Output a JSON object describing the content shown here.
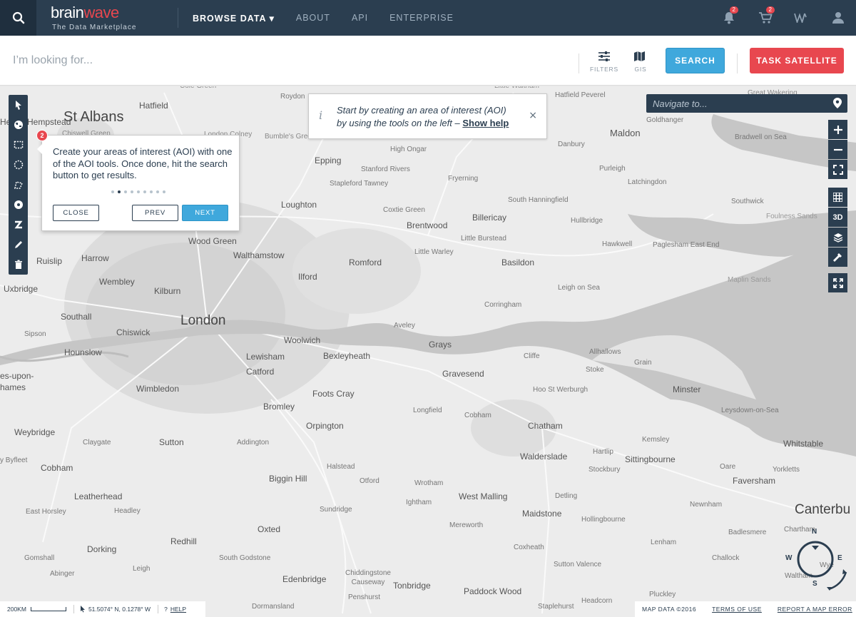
{
  "header": {
    "logo_main": "brain",
    "logo_accent": "wave",
    "logo_tagline": "The Data Marketplace",
    "nav": [
      {
        "label": "BROWSE DATA ▾",
        "active": true
      },
      {
        "label": "ABOUT",
        "active": false
      },
      {
        "label": "API",
        "active": false
      },
      {
        "label": "ENTERPRISE",
        "active": false
      }
    ],
    "notifications_count": "2",
    "cart_count": "2"
  },
  "search": {
    "placeholder": "I’m looking for...",
    "filters_label": "FILTERS",
    "gis_label": "GIS",
    "search_button": "SEARCH",
    "task_button": "TASK SATELLITE"
  },
  "tip": {
    "line1": "Start by creating an area of interest (AOI)",
    "line2": "by using the tools on the left –",
    "link": "Show help",
    "close": "×"
  },
  "tour": {
    "step": "2",
    "text": "Create your areas of interest (AOI) with one of the AOI tools. Once done, hit the search button to get results.",
    "total_steps": 9,
    "current_step": 2,
    "close": "CLOSE",
    "prev": "PREV",
    "next": "NEXT"
  },
  "navigate": {
    "placeholder": "Navigate to..."
  },
  "right_tools": {
    "three_d": "3D"
  },
  "compass": {
    "n": "N",
    "s": "S",
    "e": "E",
    "w": "W"
  },
  "footer": {
    "scale": "200KM",
    "coords": "51.5074° N, 0.1278° W",
    "help": "HELP",
    "map_data": "MAP DATA ©2016",
    "terms": "TERMS OF USE",
    "report": "REPORT A MAP ERROR"
  },
  "places": [
    {
      "t": "St Albans",
      "s": 20,
      "c": "#444"
    },
    {
      "t": "Hatfield",
      "s": 12
    },
    {
      "t": "Hemel Hempstead",
      "s": 12
    },
    {
      "t": "Cole Green",
      "s": 10,
      "c": "#888"
    },
    {
      "t": "Roydon",
      "s": 10,
      "c": "#777"
    },
    {
      "t": "Little Waltham",
      "s": 10,
      "c": "#888"
    },
    {
      "t": "Hatfield Peverel",
      "s": 10,
      "c": "#777"
    },
    {
      "t": "Great Wakering",
      "s": 10,
      "c": "#888"
    },
    {
      "t": "Goldhanger",
      "s": 10,
      "c": "#777"
    },
    {
      "t": "Maldon",
      "s": 13
    },
    {
      "t": "Bradwell on Sea",
      "s": 10,
      "c": "#777"
    },
    {
      "t": "Danbury",
      "s": 10,
      "c": "#777"
    },
    {
      "t": "Chiswell Green",
      "s": 10,
      "c": "#888"
    },
    {
      "t": "London Colney",
      "s": 10,
      "c": "#888"
    },
    {
      "t": "Bumble's Green",
      "s": 10,
      "c": "#888"
    },
    {
      "t": "High Ongar",
      "s": 10,
      "c": "#777"
    },
    {
      "t": "Epping",
      "s": 12
    },
    {
      "t": "Stanford Rivers",
      "s": 10,
      "c": "#777"
    },
    {
      "t": "Purleigh",
      "s": 10,
      "c": "#777"
    },
    {
      "t": "Fryerning",
      "s": 10,
      "c": "#777"
    },
    {
      "t": "Latchingdon",
      "s": 10,
      "c": "#777"
    },
    {
      "t": "Stapleford Tawney",
      "s": 10,
      "c": "#777"
    },
    {
      "t": "Loughton",
      "s": 12
    },
    {
      "t": "Coxtie Green",
      "s": 10,
      "c": "#777"
    },
    {
      "t": "South Hanningfield",
      "s": 10,
      "c": "#777"
    },
    {
      "t": "Southwick",
      "s": 10,
      "c": "#777"
    },
    {
      "t": "Billericay",
      "s": 12
    },
    {
      "t": "Hullbridge",
      "s": 10,
      "c": "#777"
    },
    {
      "t": "Foulness Sands",
      "s": 10,
      "c": "#999"
    },
    {
      "t": "Brentwood",
      "s": 12
    },
    {
      "t": "Little Burstead",
      "s": 10,
      "c": "#777"
    },
    {
      "t": "Wood Green",
      "s": 12
    },
    {
      "t": "Hawkwell",
      "s": 10,
      "c": "#777"
    },
    {
      "t": "Paglesham East End",
      "s": 10,
      "c": "#777"
    },
    {
      "t": "Walthamstow",
      "s": 12
    },
    {
      "t": "Little Warley",
      "s": 10,
      "c": "#777"
    },
    {
      "t": "Ruislip",
      "s": 12
    },
    {
      "t": "Harrow",
      "s": 12
    },
    {
      "t": "Romford",
      "s": 12
    },
    {
      "t": "Basildon",
      "s": 12
    },
    {
      "t": "Ilford",
      "s": 12
    },
    {
      "t": "Wembley",
      "s": 12
    },
    {
      "t": "Maplin Sands",
      "s": 10,
      "c": "#999"
    },
    {
      "t": "Uxbridge",
      "s": 12
    },
    {
      "t": "Kilburn",
      "s": 12
    },
    {
      "t": "Leigh on Sea",
      "s": 10,
      "c": "#777"
    },
    {
      "t": "Corringham",
      "s": 10,
      "c": "#777"
    },
    {
      "t": "Southall",
      "s": 12
    },
    {
      "t": "London",
      "s": 19,
      "c": "#444"
    },
    {
      "t": "Aveley",
      "s": 10,
      "c": "#777"
    },
    {
      "t": "Sipson",
      "s": 10,
      "c": "#777"
    },
    {
      "t": "Chiswick",
      "s": 12
    },
    {
      "t": "Woolwich",
      "s": 12
    },
    {
      "t": "Grays",
      "s": 12
    },
    {
      "t": "Allhallows",
      "s": 10,
      "c": "#777"
    },
    {
      "t": "Hounslow",
      "s": 12
    },
    {
      "t": "Lewisham",
      "s": 12
    },
    {
      "t": "Bexleyheath",
      "s": 12
    },
    {
      "t": "Cliffe",
      "s": 10,
      "c": "#777"
    },
    {
      "t": "Grain",
      "s": 10,
      "c": "#777"
    },
    {
      "t": "es-upon-",
      "s": 12
    },
    {
      "t": "Catford",
      "s": 12
    },
    {
      "t": "Gravesend",
      "s": 12
    },
    {
      "t": "Stoke",
      "s": 10,
      "c": "#777"
    },
    {
      "t": "hames",
      "s": 12
    },
    {
      "t": "Wimbledon",
      "s": 12
    },
    {
      "t": "Foots Cray",
      "s": 12
    },
    {
      "t": "Hoo St Werburgh",
      "s": 10,
      "c": "#777"
    },
    {
      "t": "Minster",
      "s": 12
    },
    {
      "t": "Bromley",
      "s": 12
    },
    {
      "t": "Longfield",
      "s": 10,
      "c": "#777"
    },
    {
      "t": "Cobham",
      "s": 10,
      "c": "#777"
    },
    {
      "t": "Leysdown-on-Sea",
      "s": 10,
      "c": "#777"
    },
    {
      "t": "Orpington",
      "s": 12
    },
    {
      "t": "Chatham",
      "s": 12
    },
    {
      "t": "Weybridge",
      "s": 12
    },
    {
      "t": "Claygate",
      "s": 10,
      "c": "#777"
    },
    {
      "t": "Sutton",
      "s": 12
    },
    {
      "t": "Addington",
      "s": 10,
      "c": "#777"
    },
    {
      "t": "Kemsley",
      "s": 10,
      "c": "#777"
    },
    {
      "t": "Whitstable",
      "s": 12
    },
    {
      "t": "Walderslade",
      "s": 12
    },
    {
      "t": "Sittingbourne",
      "s": 12
    },
    {
      "t": "Hartlip",
      "s": 10,
      "c": "#777"
    },
    {
      "t": "y Byfleet",
      "s": 10,
      "c": "#777"
    },
    {
      "t": "Cobham",
      "s": 12
    },
    {
      "t": "Halstead",
      "s": 10,
      "c": "#777"
    },
    {
      "t": "Oare",
      "s": 10,
      "c": "#777"
    },
    {
      "t": "Yorkletts",
      "s": 10,
      "c": "#777"
    },
    {
      "t": "Stockbury",
      "s": 10,
      "c": "#777"
    },
    {
      "t": "Biggin Hill",
      "s": 12
    },
    {
      "t": "Otford",
      "s": 10,
      "c": "#777"
    },
    {
      "t": "Wrotham",
      "s": 10,
      "c": "#777"
    },
    {
      "t": "Faversham",
      "s": 12
    },
    {
      "t": "Leatherhead",
      "s": 12
    },
    {
      "t": "West Malling",
      "s": 12
    },
    {
      "t": "Detling",
      "s": 10,
      "c": "#777"
    },
    {
      "t": "Ightham",
      "s": 10,
      "c": "#777"
    },
    {
      "t": "Newnham",
      "s": 10,
      "c": "#777"
    },
    {
      "t": "Canterbu",
      "s": 19,
      "c": "#444"
    },
    {
      "t": "East Horsley",
      "s": 10,
      "c": "#777"
    },
    {
      "t": "Headley",
      "s": 10,
      "c": "#777"
    },
    {
      "t": "Sundridge",
      "s": 10,
      "c": "#777"
    },
    {
      "t": "Maidstone",
      "s": 12
    },
    {
      "t": "Hollingbourne",
      "s": 10,
      "c": "#777"
    },
    {
      "t": "Oxted",
      "s": 12
    },
    {
      "t": "Mereworth",
      "s": 10,
      "c": "#777"
    },
    {
      "t": "Chartham",
      "s": 10,
      "c": "#777"
    },
    {
      "t": "Badlesmere",
      "s": 10,
      "c": "#777"
    },
    {
      "t": "Redhill",
      "s": 12
    },
    {
      "t": "Dorking",
      "s": 12
    },
    {
      "t": "Coxheath",
      "s": 10,
      "c": "#777"
    },
    {
      "t": "Lenham",
      "s": 10,
      "c": "#777"
    },
    {
      "t": "Gomshall",
      "s": 10,
      "c": "#777"
    },
    {
      "t": "South Godstone",
      "s": 10,
      "c": "#777"
    },
    {
      "t": "Edenbridge",
      "s": 12
    },
    {
      "t": "Sutton Valence",
      "s": 10,
      "c": "#777"
    },
    {
      "t": "Challock",
      "s": 10,
      "c": "#777"
    },
    {
      "t": "Abinger",
      "s": 10,
      "c": "#777"
    },
    {
      "t": "Leigh",
      "s": 10,
      "c": "#777"
    },
    {
      "t": "Chiddingstone Causeway",
      "s": 10,
      "c": "#777"
    },
    {
      "t": "Wye",
      "s": 10,
      "c": "#777"
    },
    {
      "t": "Tonbridge",
      "s": 12
    },
    {
      "t": "Paddock Wood",
      "s": 12
    },
    {
      "t": "Pluckley",
      "s": 10,
      "c": "#777"
    },
    {
      "t": "Penshurst",
      "s": 10,
      "c": "#777"
    },
    {
      "t": "Headcorn",
      "s": 10,
      "c": "#777"
    },
    {
      "t": "Dormansland",
      "s": 10,
      "c": "#777"
    },
    {
      "t": "Staplehurst",
      "s": 10,
      "c": "#777"
    },
    {
      "t": "Waltham",
      "s": 10,
      "c": "#777"
    }
  ]
}
